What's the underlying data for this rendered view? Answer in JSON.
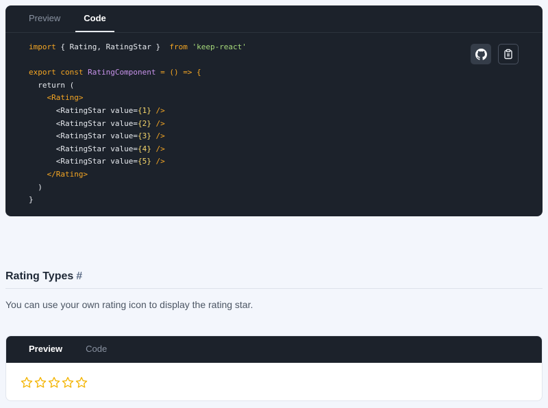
{
  "code_panel": {
    "tabs": [
      {
        "label": "Preview"
      },
      {
        "label": "Code"
      }
    ],
    "active_tab": "Code",
    "buttons": {
      "github_icon": "github-icon",
      "copy_icon": "clipboard-icon"
    }
  },
  "code": {
    "line1": {
      "kw1": "import",
      "mid": " { Rating, RatingStar }  ",
      "kw2": "from",
      "str": "'keep-react'"
    },
    "line3": {
      "kw1": "export const",
      "fn": "RatingComponent",
      "rest": " = () => {"
    },
    "line4": "  return (",
    "line5": "<Rating>",
    "stars": [
      {
        "tag": "<RatingStar",
        "attr": " value=",
        "val": "{1}",
        "end": " />"
      },
      {
        "tag": "<RatingStar",
        "attr": " value=",
        "val": "{2}",
        "end": " />"
      },
      {
        "tag": "<RatingStar",
        "attr": " value=",
        "val": "{3}",
        "end": " />"
      },
      {
        "tag": "<RatingStar",
        "attr": " value=",
        "val": "{4}",
        "end": " />"
      },
      {
        "tag": "<RatingStar",
        "attr": " value=",
        "val": "{5}",
        "end": " />"
      }
    ],
    "line11": "</Rating>",
    "line12": "  )",
    "line13": "}"
  },
  "section": {
    "title": "Rating Types",
    "hash": "#",
    "description": "You can use your own rating icon to display the rating star."
  },
  "preview_panel": {
    "tabs": [
      {
        "label": "Preview"
      },
      {
        "label": "Code"
      }
    ],
    "active_tab": "Preview",
    "rating": {
      "max": 5,
      "value": 0,
      "star_color": "#f4b400"
    }
  },
  "colors": {
    "panel_bg": "#1c222b",
    "page_bg": "#f3f6fc",
    "accent": "#f5a623"
  }
}
